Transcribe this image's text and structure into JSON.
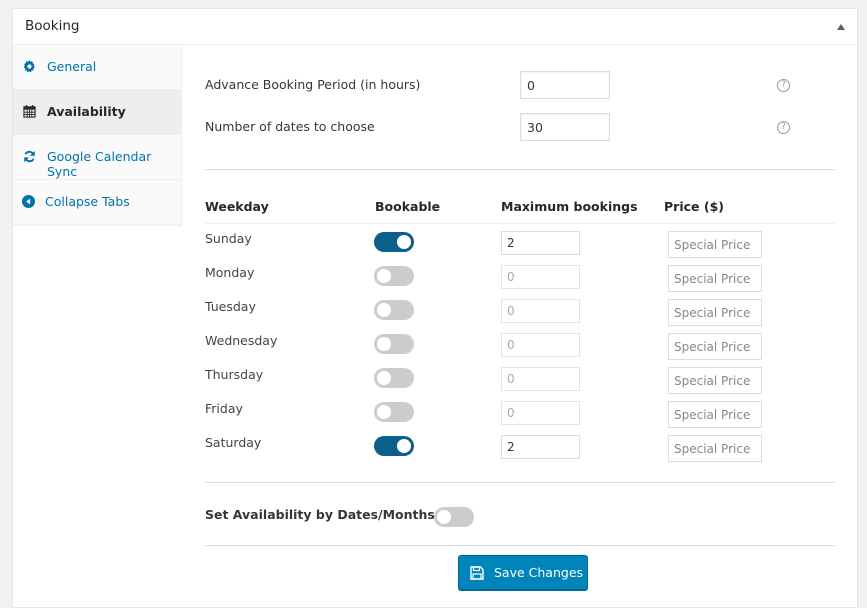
{
  "panel": {
    "title": "Booking",
    "toggle_icon": "triangle-up-icon"
  },
  "tabs": [
    {
      "label": "General",
      "icon": "gear-icon",
      "active": false
    },
    {
      "label": "Availability",
      "icon": "calendar-icon",
      "active": true
    },
    {
      "label": "Google Calendar Sync",
      "icon": "refresh-icon",
      "active": false
    },
    {
      "label": "Collapse Tabs",
      "icon": "circle-left-arrow-icon",
      "active": false
    }
  ],
  "fields": {
    "advance_label": "Advance Booking Period (in hours)",
    "advance_value": "0",
    "dates_count_label": "Number of dates to choose",
    "dates_count_value": "30",
    "help_glyph": "?"
  },
  "table": {
    "headers": [
      "Weekday",
      "Bookable",
      "Maximum bookings",
      "Price ($)"
    ],
    "price_placeholder": "Special Price",
    "rows": [
      {
        "day": "Sunday",
        "bookable": true,
        "max": "2"
      },
      {
        "day": "Monday",
        "bookable": false,
        "max": "0"
      },
      {
        "day": "Tuesday",
        "bookable": false,
        "max": "0"
      },
      {
        "day": "Wednesday",
        "bookable": false,
        "max": "0"
      },
      {
        "day": "Thursday",
        "bookable": false,
        "max": "0"
      },
      {
        "day": "Friday",
        "bookable": false,
        "max": "0"
      },
      {
        "day": "Saturday",
        "bookable": true,
        "max": "2"
      }
    ]
  },
  "dates_months": {
    "label": "Set Availability by Dates/Months",
    "enabled": false
  },
  "save_label": "Save Changes",
  "colors": {
    "accent": "#0085ba",
    "toggle_on": "#0b5f8a",
    "toggle_off": "#cccccc",
    "link": "#0073aa"
  }
}
